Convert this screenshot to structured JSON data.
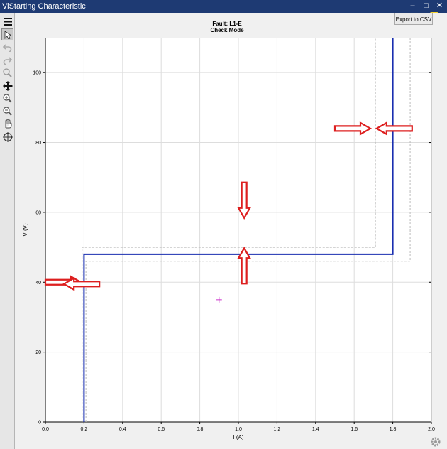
{
  "window": {
    "title": "ViStarting Characteristic"
  },
  "titlebar_controls": [
    "–",
    "□",
    "✕"
  ],
  "help": {
    "label": "?"
  },
  "toolbar": {
    "tools": [
      {
        "name": "menu-icon",
        "glyph": "☰"
      },
      {
        "name": "pointer-icon",
        "glyph": "➚"
      },
      {
        "name": "undo-icon",
        "glyph": "↶"
      },
      {
        "name": "redo-icon",
        "glyph": "↷"
      },
      {
        "name": "zoom-icon",
        "glyph": "🔍"
      },
      {
        "name": "move-icon",
        "glyph": "✥"
      },
      {
        "name": "zoom-in-icon",
        "glyph": "⊕"
      },
      {
        "name": "zoom-out-icon",
        "glyph": "⊖"
      },
      {
        "name": "hand-icon",
        "glyph": "✋"
      },
      {
        "name": "crosshair-icon",
        "glyph": "⊕"
      }
    ]
  },
  "export_button": {
    "label": "Export to CSV"
  },
  "chart_data": {
    "type": "line",
    "title_lines": [
      "Fault: L1-E",
      "Check Mode"
    ],
    "xlabel": "I (A)",
    "ylabel": "V (V)",
    "xlim": [
      0,
      2.0
    ],
    "ylim": [
      0,
      110
    ],
    "xticks": [
      "0.0",
      "0.2",
      "0.4",
      "0.6",
      "0.8",
      "1.0",
      "1.2",
      "1.4",
      "1.6",
      "1.8",
      "2.0"
    ],
    "yticks": [
      "0",
      "20",
      "40",
      "60",
      "80",
      "100"
    ],
    "grid": true,
    "series": [
      {
        "style": "solid",
        "color": "#1a2fb0",
        "x": [
          0.2,
          0.2,
          1.8,
          1.8
        ],
        "y": [
          0,
          48,
          48,
          110
        ]
      },
      {
        "style": "dashed",
        "color": "#bbbbbb",
        "x": [
          0.19,
          0.19,
          1.71,
          1.71
        ],
        "y": [
          0,
          50,
          50,
          110
        ]
      },
      {
        "style": "dashed",
        "color": "#bbbbbb",
        "x": [
          0.21,
          0.21,
          1.89,
          1.89
        ],
        "y": [
          0,
          46,
          46,
          110
        ]
      }
    ],
    "marker": {
      "x": 0.9,
      "y": 35,
      "color": "#cc33cc"
    },
    "arrow_annotations": [
      {
        "direction": "right",
        "x": 0.0,
        "y": 40
      },
      {
        "direction": "left",
        "x": 0.28,
        "y": 39.5
      },
      {
        "direction": "down",
        "x": 1.03,
        "y": 58
      },
      {
        "direction": "up",
        "x": 1.03,
        "y": 40
      },
      {
        "direction": "right",
        "x": 1.5,
        "y": 84
      },
      {
        "direction": "left",
        "x": 1.9,
        "y": 84
      }
    ],
    "arrow_color": "#dd1f1f"
  }
}
